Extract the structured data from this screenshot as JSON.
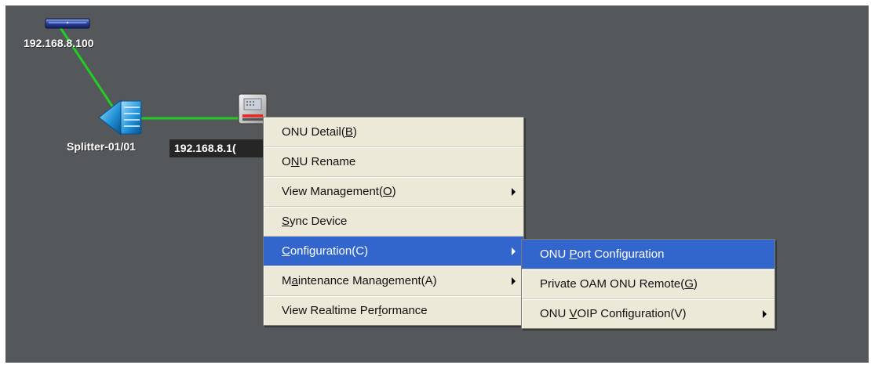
{
  "topology": {
    "olt": {
      "label": "192.168.8.100",
      "icon": "olt-device-icon"
    },
    "splitter": {
      "label": "Splitter-01/01",
      "icon": "splitter-icon"
    },
    "onu": {
      "label": "192.168.8.1(",
      "icon": "onu-device-icon"
    },
    "link_color": "#22cc22"
  },
  "context_menu": {
    "items": [
      {
        "pre": "ONU Detail(",
        "acc": "B",
        "post": ")",
        "has_submenu": false,
        "active": false
      },
      {
        "pre": "O",
        "acc": "N",
        "post": "U Rename",
        "has_submenu": false,
        "active": false
      },
      {
        "pre": "View Management(",
        "acc": "O",
        "post": ")",
        "has_submenu": true,
        "active": false
      },
      {
        "pre": "",
        "acc": "S",
        "post": "ync Device",
        "has_submenu": false,
        "active": false
      },
      {
        "pre": "",
        "acc": "C",
        "post": "onfiguration(C)",
        "has_submenu": true,
        "active": true
      },
      {
        "pre": "M",
        "acc": "a",
        "post": "intenance Management(A)",
        "has_submenu": true,
        "active": false
      },
      {
        "pre": "View Realtime Per",
        "acc": "f",
        "post": "ormance",
        "has_submenu": false,
        "active": false
      }
    ]
  },
  "submenu": {
    "items": [
      {
        "pre": "ONU ",
        "acc": "P",
        "post": "ort Configuration",
        "has_submenu": false,
        "active": true
      },
      {
        "pre": "Private OAM ONU Remote(",
        "acc": "G",
        "post": ")",
        "has_submenu": false,
        "active": false
      },
      {
        "pre": "ONU ",
        "acc": "V",
        "post": "OIP Configuration(V)",
        "has_submenu": true,
        "active": false
      }
    ]
  },
  "colors": {
    "canvas_bg": "#55585b",
    "menu_bg": "#ece9d8",
    "menu_highlight": "#3366cc"
  }
}
